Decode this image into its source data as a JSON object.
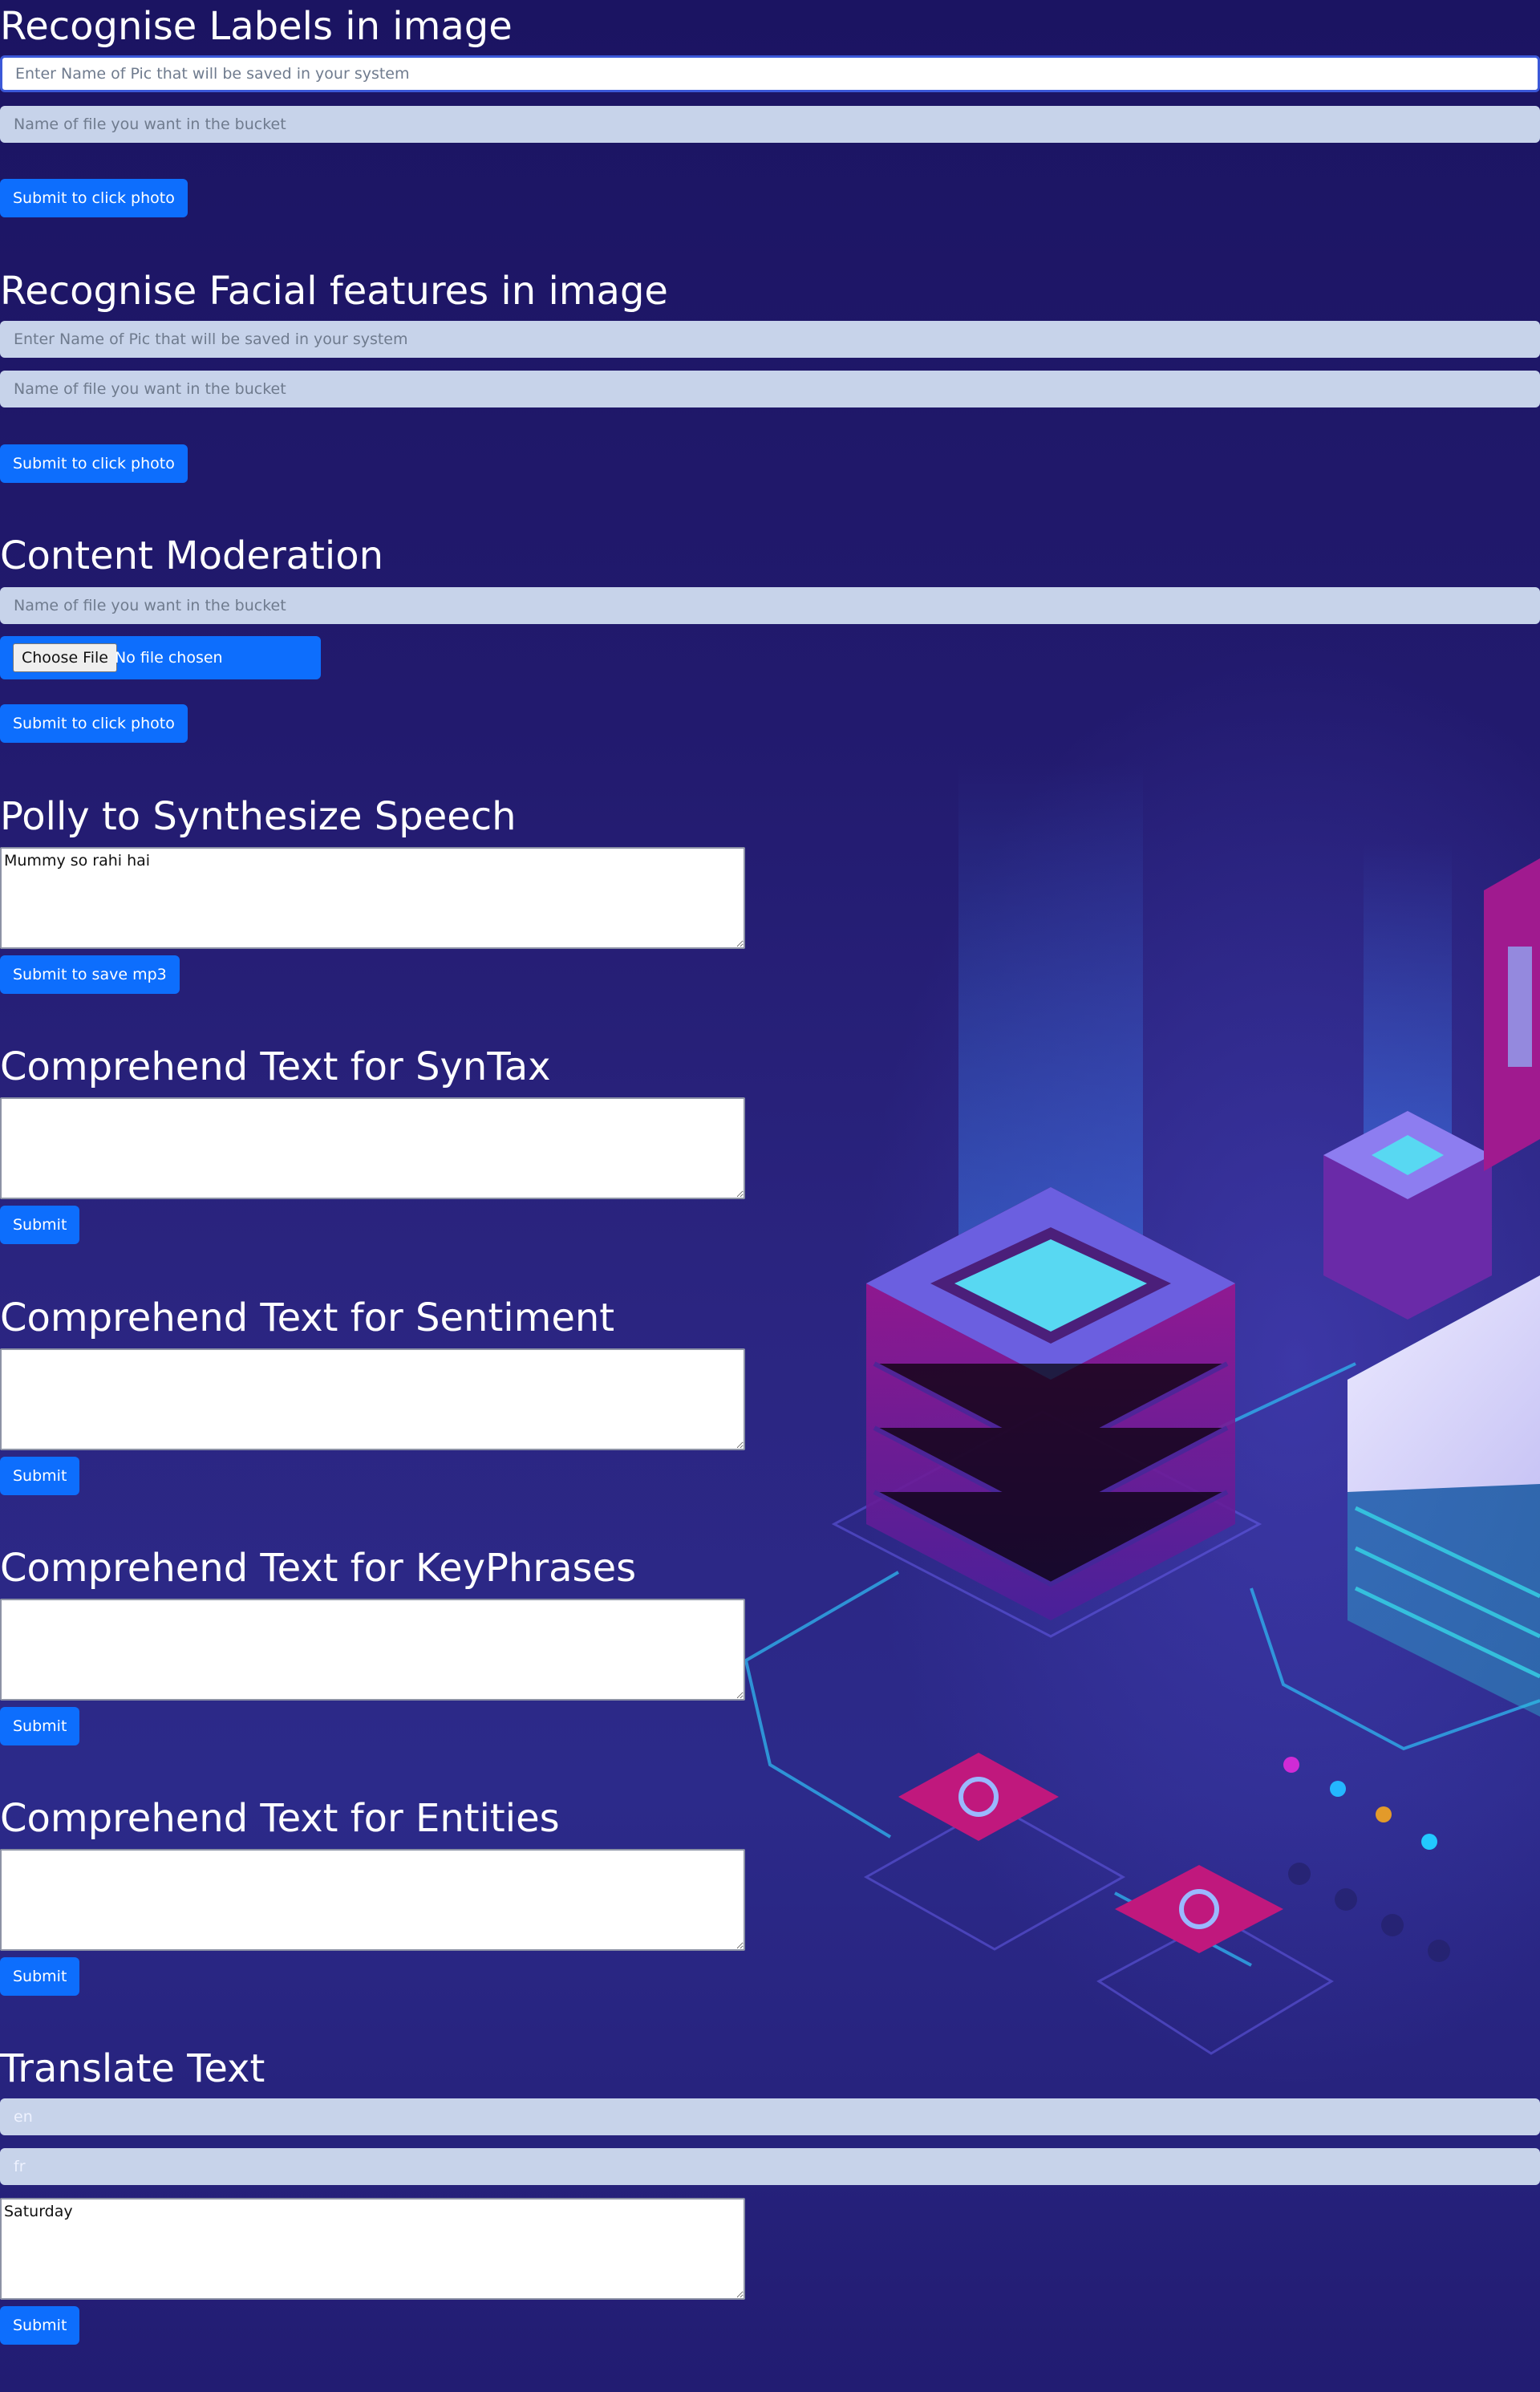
{
  "labels_section": {
    "title": "Recognise Labels in image",
    "pic_name_placeholder": "Enter Name of Pic that will be saved in your system",
    "bucket_file_placeholder": "Name of file you want in the bucket",
    "submit_label": "Submit to click photo"
  },
  "facial_section": {
    "title": "Recognise Facial features in image",
    "pic_name_placeholder": "Enter Name of Pic that will be saved in your system",
    "bucket_file_placeholder": "Name of file you want in the bucket",
    "submit_label": "Submit to click photo"
  },
  "moderation_section": {
    "title": "Content Moderation",
    "bucket_file_placeholder": "Name of file you want in the bucket",
    "choose_file_label": "Choose File",
    "file_status": "No file chosen",
    "submit_label": "Submit to click photo"
  },
  "polly_section": {
    "title": "Polly to Synthesize Speech",
    "text_value": "Mummy so rahi hai",
    "submit_label": "Submit to save mp3"
  },
  "syntax_section": {
    "title": "Comprehend Text for SynTax",
    "text_value": "",
    "submit_label": "Submit"
  },
  "sentiment_section": {
    "title": "Comprehend Text for Sentiment",
    "text_value": "",
    "submit_label": "Submit"
  },
  "keyphrases_section": {
    "title": "Comprehend Text for KeyPhrases",
    "text_value": "",
    "submit_label": "Submit"
  },
  "entities_section": {
    "title": "Comprehend Text for Entities",
    "text_value": "",
    "submit_label": "Submit"
  },
  "translate_section": {
    "title": "Translate Text",
    "source_lang_value": "en",
    "target_lang_value": "fr",
    "text_value": "Saturday",
    "submit_label": "Submit"
  },
  "colors": {
    "background_top": "#1b1462",
    "background_mid": "#2c2a8a",
    "button_blue": "#0d6efd",
    "input_fill": "#c7d3ea",
    "focus_border": "#3b58d8"
  },
  "icons": {
    "background_art": "isometric-server-illustration"
  }
}
